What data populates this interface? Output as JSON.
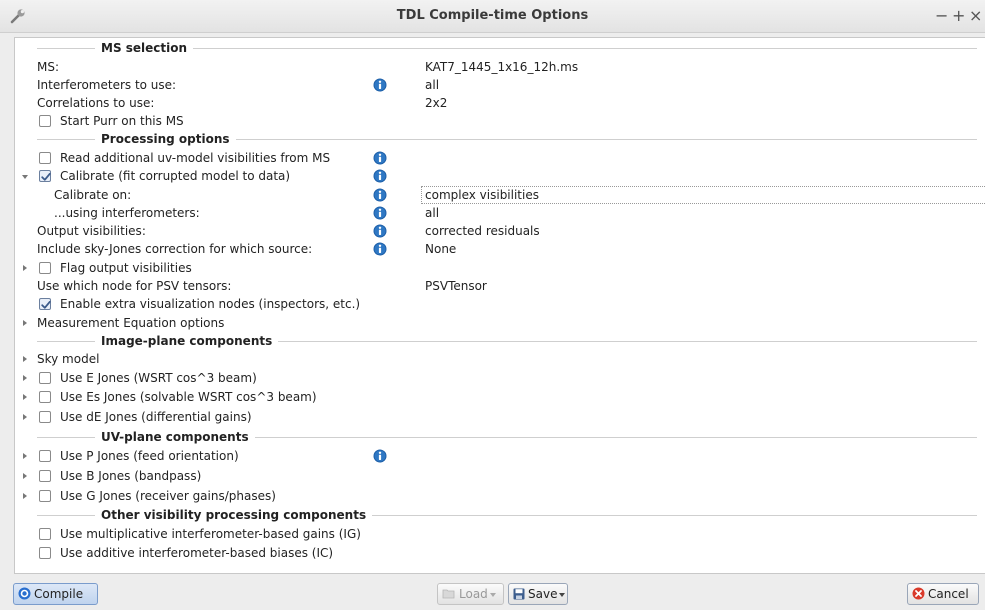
{
  "window": {
    "title": "TDL Compile-time Options",
    "controls": [
      "−",
      "+",
      "×"
    ]
  },
  "sections": {
    "ms_selection": "MS selection",
    "processing_options": "Processing options",
    "image_plane": "Image-plane components",
    "uv_plane": "UV-plane components",
    "other": "Other visibility processing components"
  },
  "ms": {
    "label": "MS:",
    "value": "KAT7_1445_1x16_12h.ms"
  },
  "interferometers": {
    "label": "Interferometers to use:",
    "value": "all"
  },
  "correlations": {
    "label": "Correlations to use:",
    "value": "2x2"
  },
  "start_purr": {
    "label": "Start Purr on this MS",
    "checked": false
  },
  "read_uv_model": {
    "label": "Read additional uv-model visibilities from MS",
    "checked": false
  },
  "calibrate": {
    "label": "Calibrate (fit corrupted model to data)",
    "checked": true
  },
  "calibrate_on": {
    "label": "Calibrate on:",
    "value": "complex visibilities"
  },
  "using_ifrs": {
    "label": "...using interferometers:",
    "value": "all"
  },
  "output_visibilities": {
    "label": "Output visibilities:",
    "value": "corrected residuals"
  },
  "sky_jones": {
    "label": "Include sky-Jones correction for which source:",
    "value": "None"
  },
  "flag_output": {
    "label": "Flag output visibilities",
    "checked": false
  },
  "psv_node": {
    "label": "Use which node for PSV tensors:",
    "value": "PSVTensor"
  },
  "extra_vis": {
    "label": "Enable extra visualization nodes (inspectors, etc.)",
    "checked": true
  },
  "meq_options": {
    "label": "Measurement Equation options"
  },
  "sky_model": {
    "label": "Sky model"
  },
  "e_jones": {
    "label": "Use E Jones (WSRT cos^3 beam)",
    "checked": false
  },
  "es_jones": {
    "label": "Use Es Jones (solvable WSRT cos^3 beam)",
    "checked": false
  },
  "de_jones": {
    "label": "Use dE Jones (differential gains)",
    "checked": false
  },
  "p_jones": {
    "label": "Use P Jones (feed orientation)",
    "checked": false
  },
  "b_jones": {
    "label": "Use B Jones (bandpass)",
    "checked": false
  },
  "g_jones": {
    "label": "Use G Jones (receiver gains/phases)",
    "checked": false
  },
  "ig_gains": {
    "label": "Use multiplicative interferometer-based gains (IG)",
    "checked": false
  },
  "ic_biases": {
    "label": "Use additive interferometer-based biases (IC)",
    "checked": false
  },
  "buttons": {
    "compile": "Compile",
    "load": "Load",
    "save": "Save",
    "cancel": "Cancel"
  },
  "colors": {
    "info_icon": "#1d5fa8",
    "panel_bg": "#ffffff",
    "window_bg": "#ededed"
  }
}
